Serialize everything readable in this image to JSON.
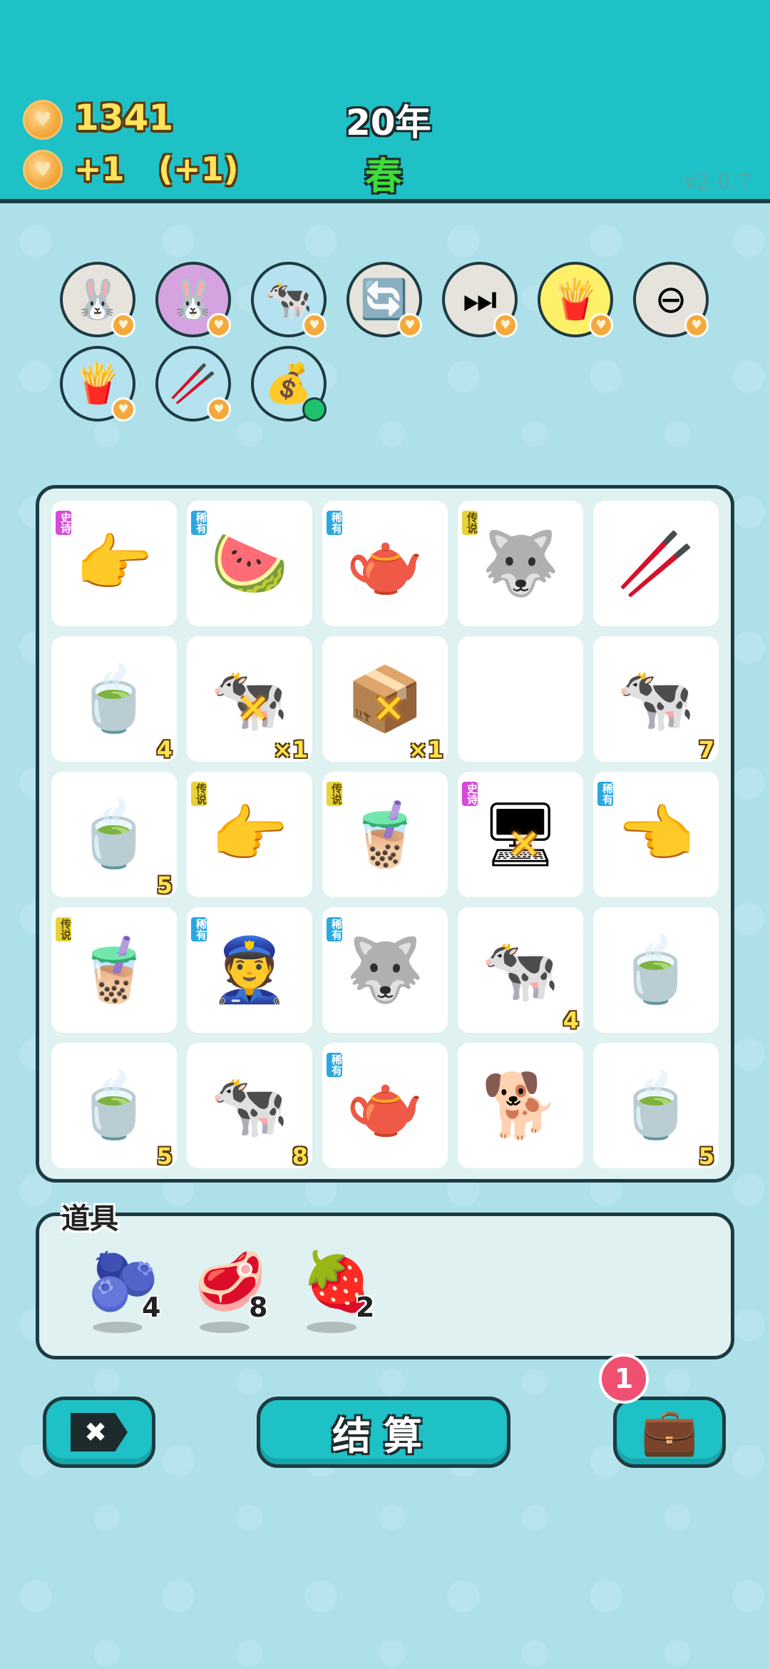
{
  "header": {
    "coins": "1341",
    "income": "+1",
    "income_bonus": "(+1)",
    "year": "20年",
    "season": "春",
    "version": "v2.0.7"
  },
  "buffs": [
    {
      "name": "rabbit-buff",
      "icon": "🐰",
      "bg": "#e6e3dc"
    },
    {
      "name": "rabbit-purple-buff",
      "icon": "🐰",
      "bg": "#d5a4e0"
    },
    {
      "name": "cow-pair-buff",
      "icon": "🐄",
      "bg": "#b4e2ee"
    },
    {
      "name": "refresh-buff",
      "icon": "🔄",
      "bg": "#e6e3dc"
    },
    {
      "name": "skip-buff",
      "icon": "⏭",
      "bg": "#e6e3dc"
    },
    {
      "name": "fries-buff",
      "icon": "🍟",
      "bg": "#fff06a"
    },
    {
      "name": "minus-buff",
      "icon": "⊖",
      "bg": "#e6e3dc"
    },
    {
      "name": "fries-blue-buff",
      "icon": "🍟",
      "bg": "#b4e2ee"
    },
    {
      "name": "straw-buff",
      "icon": "🥢",
      "bg": "#b4e2ee"
    },
    {
      "name": "sack-buff",
      "icon": "💰",
      "bg": "#b4e2ee"
    }
  ],
  "rarity_labels": {
    "epic": "史诗",
    "rare": "稀有",
    "legend": "传说"
  },
  "grid": [
    {
      "icon": "👉",
      "rarity": "epic",
      "count": "",
      "mark": false
    },
    {
      "icon": "🍉",
      "rarity": "rare",
      "count": "",
      "mark": false
    },
    {
      "icon": "🫖",
      "rarity": "rare",
      "count": "",
      "mark": false
    },
    {
      "icon": "🐺",
      "rarity": "legend",
      "count": "",
      "mark": false
    },
    {
      "icon": "🥢",
      "rarity": "",
      "count": "",
      "mark": false
    },
    {
      "icon": "🍵",
      "rarity": "",
      "count": "4",
      "mark": false
    },
    {
      "icon": "🐄",
      "rarity": "",
      "count": "×1",
      "mark": true
    },
    {
      "icon": "📦",
      "rarity": "",
      "count": "×1",
      "mark": true
    },
    {
      "icon": "",
      "rarity": "",
      "count": "",
      "mark": false
    },
    {
      "icon": "🐄",
      "rarity": "",
      "count": "7",
      "mark": false
    },
    {
      "icon": "🍵",
      "rarity": "",
      "count": "5",
      "mark": false
    },
    {
      "icon": "👉",
      "rarity": "legend",
      "count": "",
      "mark": false
    },
    {
      "icon": "🧋",
      "rarity": "legend",
      "count": "",
      "mark": false
    },
    {
      "icon": "🖥",
      "rarity": "epic",
      "count": "",
      "mark": true
    },
    {
      "icon": "👈",
      "rarity": "rare",
      "count": "",
      "mark": false
    },
    {
      "icon": "🧋",
      "rarity": "legend",
      "count": "",
      "mark": false
    },
    {
      "icon": "👮",
      "rarity": "rare",
      "count": "",
      "mark": false
    },
    {
      "icon": "🐺",
      "rarity": "rare",
      "count": "",
      "mark": false
    },
    {
      "icon": "🐄",
      "rarity": "",
      "count": "4",
      "mark": false
    },
    {
      "icon": "🍵",
      "rarity": "",
      "count": "",
      "mark": false
    },
    {
      "icon": "🍵",
      "rarity": "",
      "count": "5",
      "mark": false
    },
    {
      "icon": "🐄",
      "rarity": "",
      "count": "8",
      "mark": false
    },
    {
      "icon": "🫖",
      "rarity": "rare",
      "count": "",
      "mark": false
    },
    {
      "icon": "🐕",
      "rarity": "",
      "count": "",
      "mark": false
    },
    {
      "icon": "🍵",
      "rarity": "",
      "count": "5",
      "mark": false
    }
  ],
  "mark_symbol": "✕",
  "items_panel": {
    "title": "道具",
    "props": [
      {
        "name": "blueberry",
        "icon": "🫐",
        "qty": "4"
      },
      {
        "name": "liver",
        "icon": "🥩",
        "qty": "8"
      },
      {
        "name": "strawberry",
        "icon": "🍓",
        "qty": "2"
      }
    ]
  },
  "buttons": {
    "exit_symbol": "✖",
    "settle_label": "结算",
    "bag_icon": "💼",
    "bag_notification": "1"
  }
}
